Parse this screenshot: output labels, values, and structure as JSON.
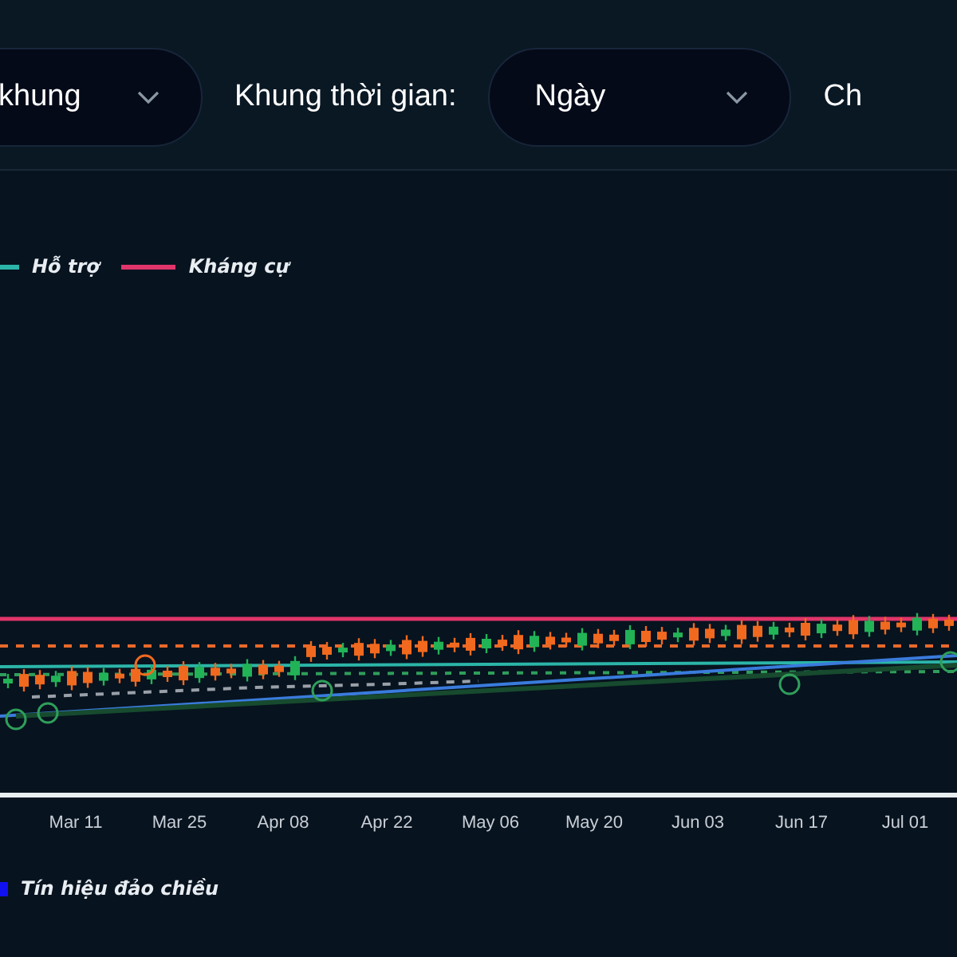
{
  "toolbar": {
    "dropdown_1": {
      "value": "khung"
    },
    "timeframe": {
      "label": "Khung thời gian:",
      "value": "Ngày"
    },
    "label_3": "Ch"
  },
  "chart": {
    "legend": [
      {
        "label": "Hỗ trợ",
        "color": "#2bb5a8"
      },
      {
        "label": "Kháng cự",
        "color": "#e0356a"
      }
    ],
    "x_labels": [
      "Mar 11",
      "Mar 25",
      "Apr 08",
      "Apr 22",
      "May 06",
      "May 20",
      "Jun 03",
      "Jun 17",
      "Jul 01"
    ]
  },
  "bottom_legend": [
    {
      "label": "Tín hiệu đảo chiều",
      "color": "#1010f0"
    }
  ]
}
